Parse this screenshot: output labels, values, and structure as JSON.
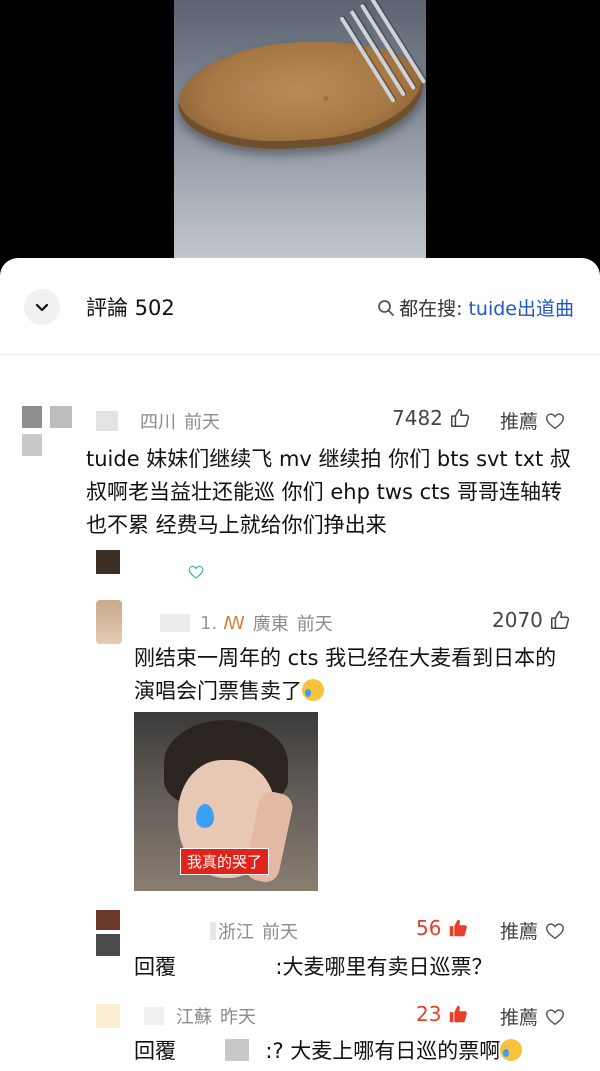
{
  "header": {
    "comments_label": "評論 502",
    "search_prefix": "都在搜:",
    "search_term": "tuide出道曲"
  },
  "comments": [
    {
      "location": "四川",
      "time": "前天",
      "likes": "7482",
      "recommend": "推薦",
      "text": "tuide 妹妹们继续飞 mv 继续拍 你们 bts svt txt 叔叔啊老当益壮还能巡 你们 ehp tws cts 哥哥连轴转也不累 经费马上就给你们挣出来"
    }
  ],
  "replies": [
    {
      "name_suffix": "1.",
      "location": "廣東",
      "time": "前天",
      "likes": "2070",
      "text": "刚结束一周年的 cts 我已经在大麦看到日本的演唱会门票售卖了",
      "image_caption": "我真的哭了"
    },
    {
      "location": "浙江",
      "time": "前天",
      "likes": "56",
      "recommend": "推薦",
      "reply_prefix": "回覆",
      "text": ":大麦哪里有卖日巡票？"
    },
    {
      "location": "江蘇",
      "time": "昨天",
      "likes": "23",
      "recommend": "推薦",
      "reply_prefix": "回覆",
      "text": ":? 大麦上哪有日巡的票啊"
    }
  ],
  "colors": {
    "link": "#1e57c9",
    "hot": "#e5402b",
    "muted": "#8c8c8c"
  },
  "icons": {
    "collapse": "chevron-down-icon",
    "search": "search-icon",
    "like": "thumbs-up-icon",
    "recommend": "heart-icon"
  }
}
